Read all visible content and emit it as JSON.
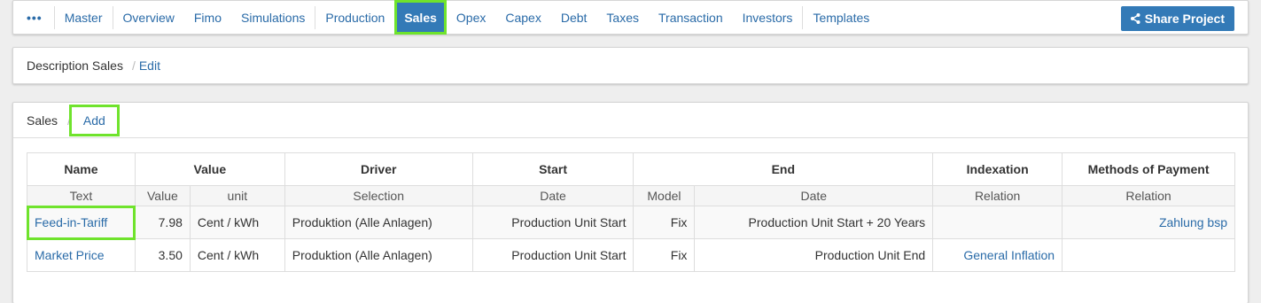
{
  "nav": {
    "menu_icon": "ellipsis-icon",
    "items": [
      "Master",
      "Overview",
      "Fimo",
      "Simulations",
      "Production",
      "Sales",
      "Opex",
      "Capex",
      "Debt",
      "Taxes",
      "Transaction",
      "Investors",
      "Templates"
    ],
    "active": "Sales",
    "share_label": "Share Project",
    "share_icon": "share-icon"
  },
  "description": {
    "title": "Description Sales",
    "separator": "/",
    "edit_label": "Edit"
  },
  "sales": {
    "title": "Sales",
    "separator": "/",
    "add_label": "Add",
    "header_groups": [
      "Name",
      "Value",
      "Driver",
      "Start",
      "End",
      "Indexation",
      "Methods of Payment"
    ],
    "sub_headers": [
      "Text",
      "Value",
      "unit",
      "Selection",
      "Date",
      "Model",
      "Date",
      "Relation",
      "Relation"
    ],
    "rows": [
      {
        "name": "Feed-in-Tariff",
        "value": "7.98",
        "unit": "Cent / kWh",
        "selection": "Produktion (Alle Anlagen)",
        "start_date": "Production Unit Start",
        "end_model": "Fix",
        "end_date": "Production Unit Start + 20 Years",
        "indexation": "",
        "payment": "Zahlung bsp"
      },
      {
        "name": "Market Price",
        "value": "3.50",
        "unit": "Cent / kWh",
        "selection": "Produktion (Alle Anlagen)",
        "start_date": "Production Unit Start",
        "end_model": "Fix",
        "end_date": "Production Unit End",
        "indexation": "General Inflation",
        "payment": ""
      }
    ]
  },
  "colors": {
    "link": "#2a6ba8",
    "active_bg": "#337ab7",
    "highlight": "#6fe32c"
  }
}
